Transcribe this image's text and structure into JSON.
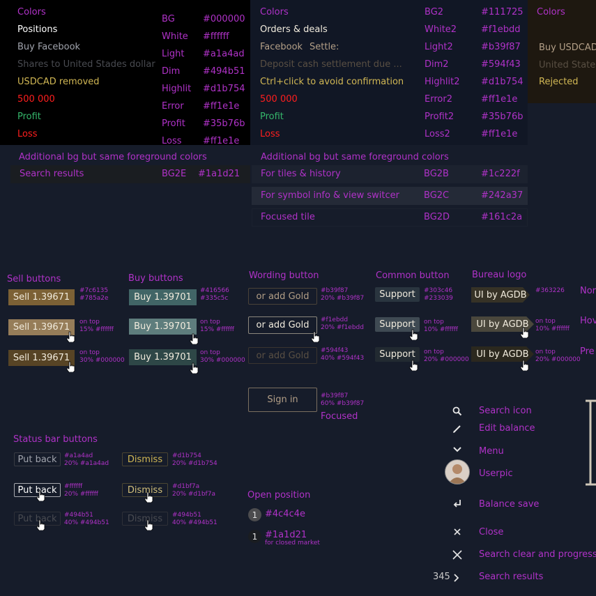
{
  "panel1": {
    "header": "Colors",
    "rows": [
      {
        "label": "Positions",
        "name": "BG",
        "hex": "#000000",
        "color": "#ffffff"
      },
      {
        "label": "Buy Facebook",
        "name": "White",
        "hex": "#ffffff",
        "color": "#a1a4ad"
      },
      {
        "label": "Shares to United Stades dollar",
        "name": "Light",
        "hex": "#a1a4ad",
        "color": "#494b51"
      },
      {
        "label": "USDCAD removed",
        "name": "Dim",
        "hex": "#494b51",
        "color": "#d1b754"
      },
      {
        "label": "500 000",
        "name": "Highlit",
        "hex": "#d1b754",
        "color": "#ff1e1e"
      },
      {
        "label": "Profit",
        "name": "Error",
        "hex": "#ff1e1e",
        "color": "#35b76b"
      },
      {
        "label": "Loss",
        "name": "Profit",
        "hex": "#35b76b",
        "color": "#ff1e1e"
      },
      {
        "label": "",
        "name": "Loss",
        "hex": "#ff1e1e",
        "color": "#ff1e1e"
      }
    ]
  },
  "panel2": {
    "header": "Colors",
    "orders": "Orders & deals",
    "facebook": "Facebook",
    "settle": "Settle:",
    "deposit": "Deposit cash settlement due ...",
    "ctrl": "Ctrl+click to avoid confirmation",
    "amount": "500 000",
    "profit": "Profit",
    "loss": "Loss",
    "names": [
      "BG2",
      "White2",
      "Light2",
      "Dim2",
      "Highlit2",
      "Error2",
      "Profit2",
      "Loss2"
    ],
    "hexes": [
      "#111725",
      "#f1ebdd",
      "#b39f87",
      "#594f43",
      "#d1b754",
      "#ff1e1e",
      "#35b76b",
      "#ff1e1e"
    ]
  },
  "panel3": {
    "header": "Colors",
    "buy": "Buy USDCAD",
    "united": "United States",
    "rejected": "Rejected"
  },
  "additional_left": {
    "title": "Additional bg but same foreground colors",
    "label": "Search results",
    "name": "BG2E",
    "hex": "#1a1d21"
  },
  "additional_right": {
    "title": "Additional bg but same foreground colors",
    "rows": [
      {
        "label": "For tiles & history",
        "name": "BG2B",
        "hex": "#1c222f"
      },
      {
        "label": "For symbol info & view switcer",
        "name": "BG2C",
        "hex": "#242a37"
      },
      {
        "label": "Focused tile",
        "name": "BG2D",
        "hex": "#161c2a"
      }
    ]
  },
  "sell": {
    "title": "Sell  buttons",
    "label": "Sell 1.39671",
    "notes": [
      [
        "#7c6135",
        "#785a2e"
      ],
      [
        "on top",
        "15% #ffffff"
      ],
      [
        "on top",
        "30% #000000"
      ]
    ]
  },
  "buy": {
    "title": "Buy buttons",
    "label": "Buy 1.39701",
    "notes": [
      [
        "#416566",
        "#335c5c"
      ],
      [
        "on top",
        "15% #ffffff"
      ],
      [
        "on top",
        "30% #000000"
      ]
    ]
  },
  "wording": {
    "title": "Wording button",
    "label": "or add Gold",
    "notes": [
      [
        "#b39f87",
        "20% #b39f87"
      ],
      [
        "#f1ebdd",
        "20% #f1ebdd"
      ],
      [
        "#594f43",
        "40% #594f43"
      ]
    ],
    "signin": "Sign in",
    "signin_notes": [
      "#b39f87",
      "60% #b39f87"
    ],
    "focused": "Focused"
  },
  "common": {
    "title": "Common button",
    "label": "Support",
    "notes": [
      [
        "#303c46",
        "#233039"
      ],
      [
        "on top",
        "10% #ffffff"
      ],
      [
        "on top",
        "20% #000000"
      ]
    ]
  },
  "bureau": {
    "title": "Bureau logo",
    "label": "UI by AGDB",
    "notes": [
      [
        "#363226",
        ""
      ],
      [
        "on top",
        "10% #ffffff"
      ],
      [
        "on top",
        "20% #000000"
      ]
    ],
    "states": [
      "Nor",
      "Hov",
      "Pre"
    ]
  },
  "status": {
    "title": "Status bar buttons",
    "put_back": "Put back",
    "dismiss": "Dismiss",
    "put_notes": [
      [
        "#a1a4ad",
        "20% #a1a4ad"
      ],
      [
        "#ffffff",
        "20% #ffffff"
      ],
      [
        "#494b51",
        "40% #494b51"
      ]
    ],
    "dismiss_notes": [
      [
        "#d1b754",
        "20% #d1b754"
      ],
      [
        "#d1bf7a",
        "20% #d1bf7a"
      ],
      [
        "#494b51",
        "40% #494b51"
      ]
    ]
  },
  "open_position": {
    "title": "Open position",
    "badge": "1",
    "hex1": "#4c4c4e",
    "hex2": "#1a1d21",
    "sub": "for closed market"
  },
  "icons": {
    "search": "Search icon",
    "edit": "Edit balance",
    "menu": "Menu",
    "userpic": "Userpic",
    "balance_save": "Balance save",
    "close": "Close",
    "search_clear": "Search clear and progress",
    "count": "345",
    "search_results": "Search results"
  }
}
